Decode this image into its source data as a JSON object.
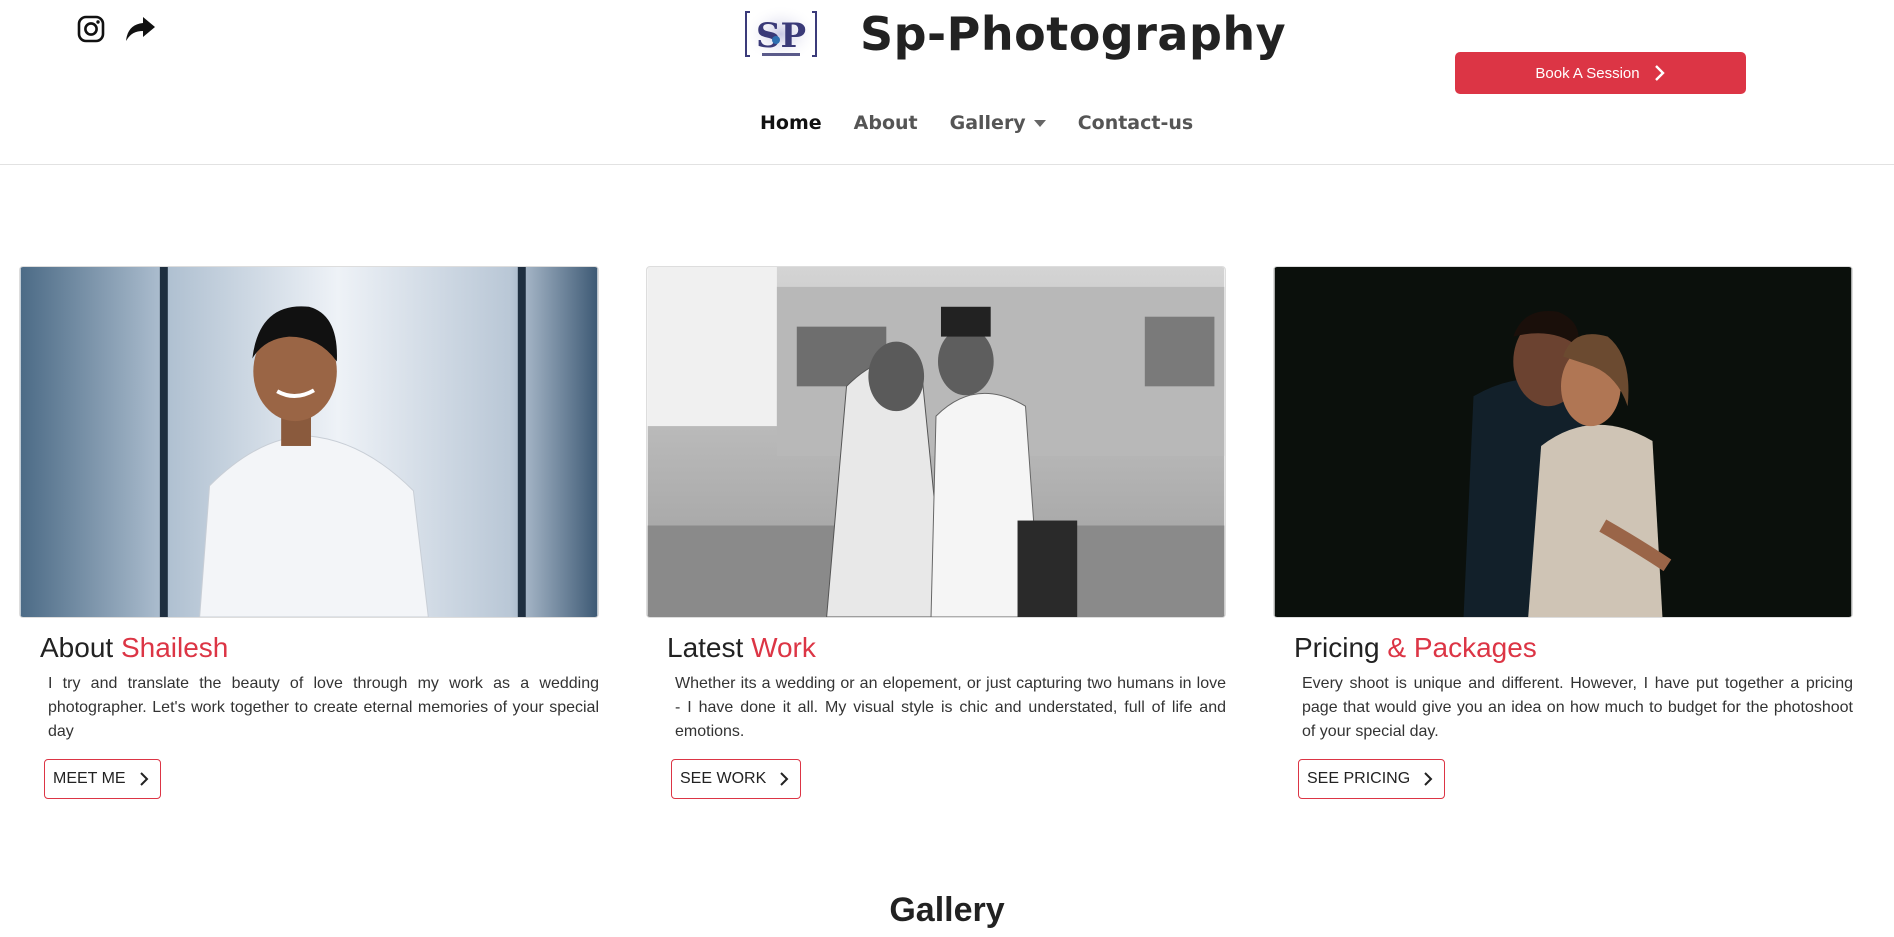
{
  "header": {
    "site_title": "Sp-Photography",
    "logo_text": "SP",
    "social": [
      {
        "icon": "instagram-icon"
      },
      {
        "icon": "share-icon"
      }
    ],
    "book_button_label": "Book A Session",
    "accent_color": "#dc3545"
  },
  "nav": {
    "items": [
      {
        "label": "Home",
        "active": true
      },
      {
        "label": "About",
        "active": false
      },
      {
        "label": "Gallery",
        "active": false,
        "dropdown": true
      },
      {
        "label": "Contact-us",
        "active": false
      }
    ]
  },
  "cards": [
    {
      "title_main": "About",
      "title_accent": "Shailesh",
      "text": "I try and translate the beauty of love through my work as a wedding photographer. Let's work together to create eternal memories of your special day",
      "button_label": "MEET ME"
    },
    {
      "title_main": "Latest",
      "title_accent": "Work",
      "text": "Whether its a wedding or an elopement, or just capturing two humans in love - I have done it all. My visual style is chic and understated, full of life and emotions.",
      "button_label": "SEE WORK"
    },
    {
      "title_main": "Pricing",
      "title_accent": "& Packages",
      "text": "Every shoot is unique and different. However, I have put together a pricing page that would give you an idea on how much to budget for the photoshoot of your special day.",
      "button_label": "SEE PRICING"
    }
  ],
  "gallery": {
    "title": "Gallery"
  }
}
